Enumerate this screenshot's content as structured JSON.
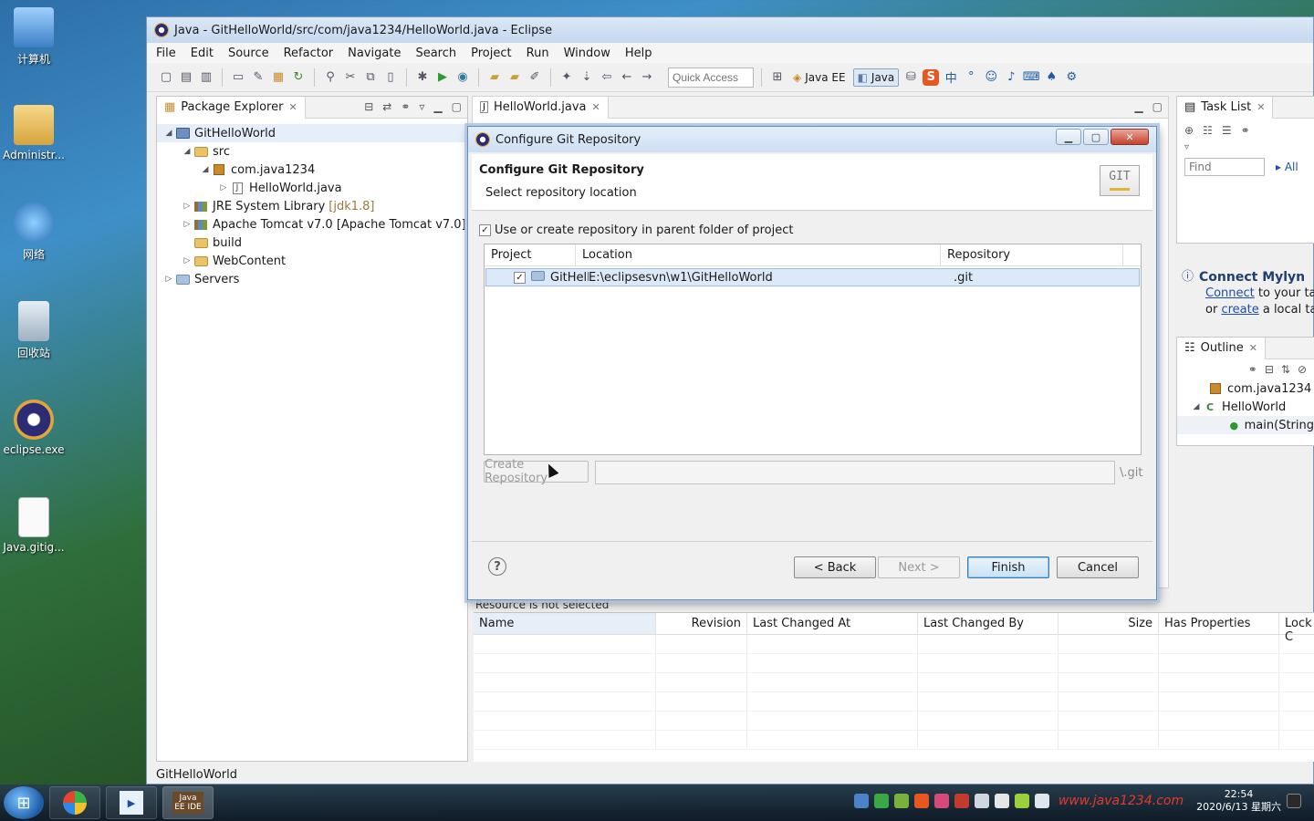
{
  "desktop": {
    "icons": [
      {
        "label": "计算机"
      },
      {
        "label": "Administr..."
      },
      {
        "label": "网络"
      },
      {
        "label": "回收站"
      },
      {
        "label": "eclipse.exe"
      },
      {
        "label": "Java.gitig..."
      }
    ]
  },
  "window": {
    "title": "Java - GitHelloWorld/src/com/java1234/HelloWorld.java - Eclipse"
  },
  "menubar": {
    "items": [
      "File",
      "Edit",
      "Source",
      "Refactor",
      "Navigate",
      "Search",
      "Project",
      "Run",
      "Window",
      "Help"
    ]
  },
  "toolbar": {
    "quick_access_placeholder": "Quick Access",
    "perspectives": [
      {
        "label": "Java EE"
      },
      {
        "label": "Java"
      }
    ]
  },
  "package_explorer": {
    "tab_label": "Package Explorer",
    "tree": [
      {
        "label": "GitHelloWorld",
        "extra": ""
      },
      {
        "label": "src",
        "extra": ""
      },
      {
        "label": "com.java1234",
        "extra": ""
      },
      {
        "label": "HelloWorld.java",
        "extra": ""
      },
      {
        "label": "JRE System Library",
        "extra": "[jdk1.8]"
      },
      {
        "label": "Apache Tomcat v7.0 [Apache Tomcat v7.0]",
        "extra": ""
      },
      {
        "label": "build",
        "extra": ""
      },
      {
        "label": "WebContent",
        "extra": ""
      },
      {
        "label": "Servers",
        "extra": ""
      }
    ]
  },
  "editor": {
    "tab_label": "HelloWorld.java"
  },
  "task_list": {
    "tab_label": "Task List",
    "find_placeholder": "Find",
    "all_label": "All"
  },
  "mylyn": {
    "title": "Connect Mylyn",
    "connect_link": "Connect",
    "line1_rest": " to your task",
    "or_text": "or ",
    "create_link": "create",
    "line2_rest": " a local task"
  },
  "outline": {
    "tab_label": "Outline",
    "items": [
      {
        "label": "com.java1234"
      },
      {
        "label": "HelloWorld"
      },
      {
        "label": "main(String"
      }
    ]
  },
  "svn_view": {
    "info": "Resource is not selected",
    "columns": [
      "Name",
      "Revision",
      "Last Changed At",
      "Last Changed By",
      "Size",
      "Has Properties",
      "Lock C"
    ]
  },
  "status_bar": {
    "text": "GitHelloWorld"
  },
  "dialog": {
    "title": "Configure Git Repository",
    "banner_title": "Configure Git Repository",
    "banner_subtitle": "Select repository location",
    "git_logo": "GIT",
    "parent_checkbox_label": "Use or create repository in parent folder of project",
    "parent_checkbox_checked": true,
    "table_columns": [
      "Project",
      "Location",
      "Repository"
    ],
    "rows": [
      {
        "project": "GitHell",
        "location": "E:\\eclipsesvn\\w1\\GitHelloWorld",
        "repository": ".git",
        "checked": true
      }
    ],
    "create_repository_label": "Create Repository",
    "git_suffix": "\\.git",
    "back_label": "< Back",
    "next_label": "Next >",
    "finish_label": "Finish",
    "cancel_label": "Cancel"
  },
  "taskbar": {
    "time": "22:54",
    "date": "2020/6/13 星期六",
    "eclipse_item": "Java EE IDE",
    "watermark": "www.java1234.com"
  }
}
